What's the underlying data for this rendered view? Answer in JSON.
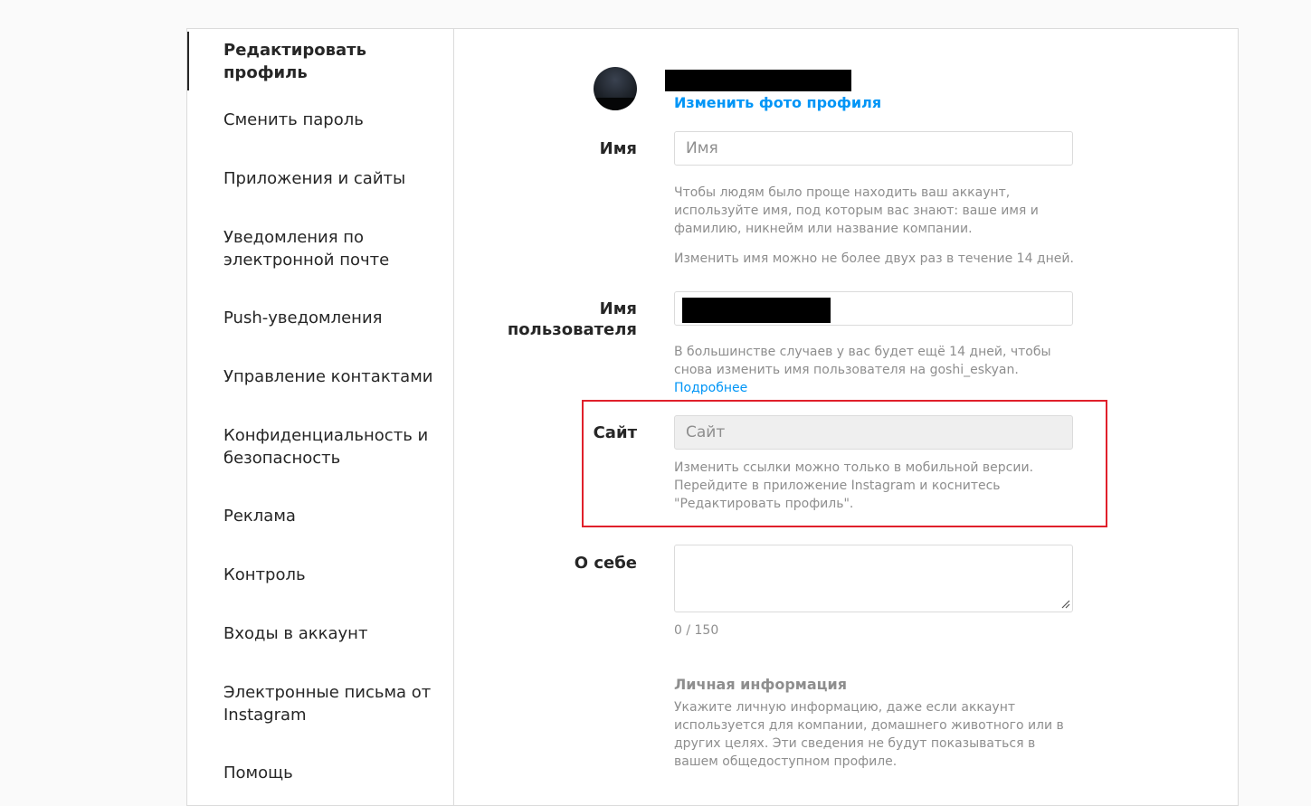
{
  "sidebar": {
    "items": [
      {
        "label": "Редактировать профиль"
      },
      {
        "label": "Сменить пароль"
      },
      {
        "label": "Приложения и сайты"
      },
      {
        "label": "Уведомления по электронной почте"
      },
      {
        "label": "Push-уведомления"
      },
      {
        "label": "Управление контактами"
      },
      {
        "label": "Конфиденциальность и безопасность"
      },
      {
        "label": "Реклама"
      },
      {
        "label": "Контроль"
      },
      {
        "label": "Входы в аккаунт"
      },
      {
        "label": "Электронные письма от Instagram"
      },
      {
        "label": "Помощь"
      }
    ]
  },
  "profile": {
    "change_photo": "Изменить фото профиля"
  },
  "name_field": {
    "label": "Имя",
    "placeholder": "Имя",
    "help_1": "Чтобы людям было проще находить ваш аккаунт, используйте имя, под которым вас знают: ваше имя и фамилию, никнейм или название компании.",
    "help_2": "Изменить имя можно не более двух раз в течение 14 дней."
  },
  "username_field": {
    "label_line1": "Имя",
    "label_line2": "пользователя",
    "help": "В большинстве случаев у вас будет ещё 14 дней, чтобы снова изменить имя пользователя на goshi_eskyan.",
    "help_link": "Подробнее"
  },
  "website_field": {
    "label": "Сайт",
    "placeholder": "Сайт",
    "help": "Изменить ссылки можно только в мобильной версии. Перейдите в приложение Instagram и коснитесь \"Редактировать профиль\"."
  },
  "bio_field": {
    "label": "О себе",
    "counter": "0 / 150"
  },
  "personal_info": {
    "title": "Личная информация",
    "text": "Укажите личную информацию, даже если аккаунт используется для компании, домашнего животного или в других целях. Эти сведения не будут показываться в вашем общедоступном профиле."
  },
  "colors": {
    "accent": "#0095f6",
    "highlight_border": "#e0202b",
    "muted_text": "#8e8e8e"
  }
}
